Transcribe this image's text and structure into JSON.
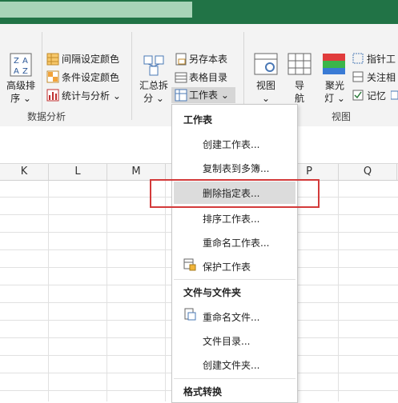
{
  "ribbon": {
    "sort_advanced": {
      "line1": "高级排",
      "line2": "序 ⌄"
    },
    "interval_color": "间隔设定颜色",
    "cond_color": "条件设定颜色",
    "stats": "统计与分析 ⌄",
    "group_data_analysis": "数据分析",
    "summary_split": {
      "line1": "汇总拆",
      "line2": "分 ⌄"
    },
    "save_as_sheet": "另存本表",
    "table_dir": "表格目录",
    "worksheet": "工作表 ⌄",
    "view": {
      "line1": "视图",
      "line2": "⌄"
    },
    "nav": {
      "line1": "导",
      "line2": "航"
    },
    "spotlight": {
      "line1": "聚光",
      "line2": "灯 ⌄"
    },
    "group_view": "视图",
    "pointer": "指针工",
    "follow": "关注相",
    "memo": "记忆"
  },
  "columns": [
    "K",
    "L",
    "M",
    "",
    "P",
    "Q"
  ],
  "menu": {
    "header1": "工作表",
    "items1": [
      "创建工作表...",
      "复制表到多簿...",
      "删除指定表...",
      "排序工作表...",
      "重命名工作表...",
      "保护工作表"
    ],
    "header2": "文件与文件夹",
    "items2": [
      "重命名文件...",
      "文件目录...",
      "创建文件夹..."
    ],
    "header3": "格式转换"
  },
  "colors": {
    "titlebar": "#217346",
    "highlight_box": "#d33a3a"
  }
}
